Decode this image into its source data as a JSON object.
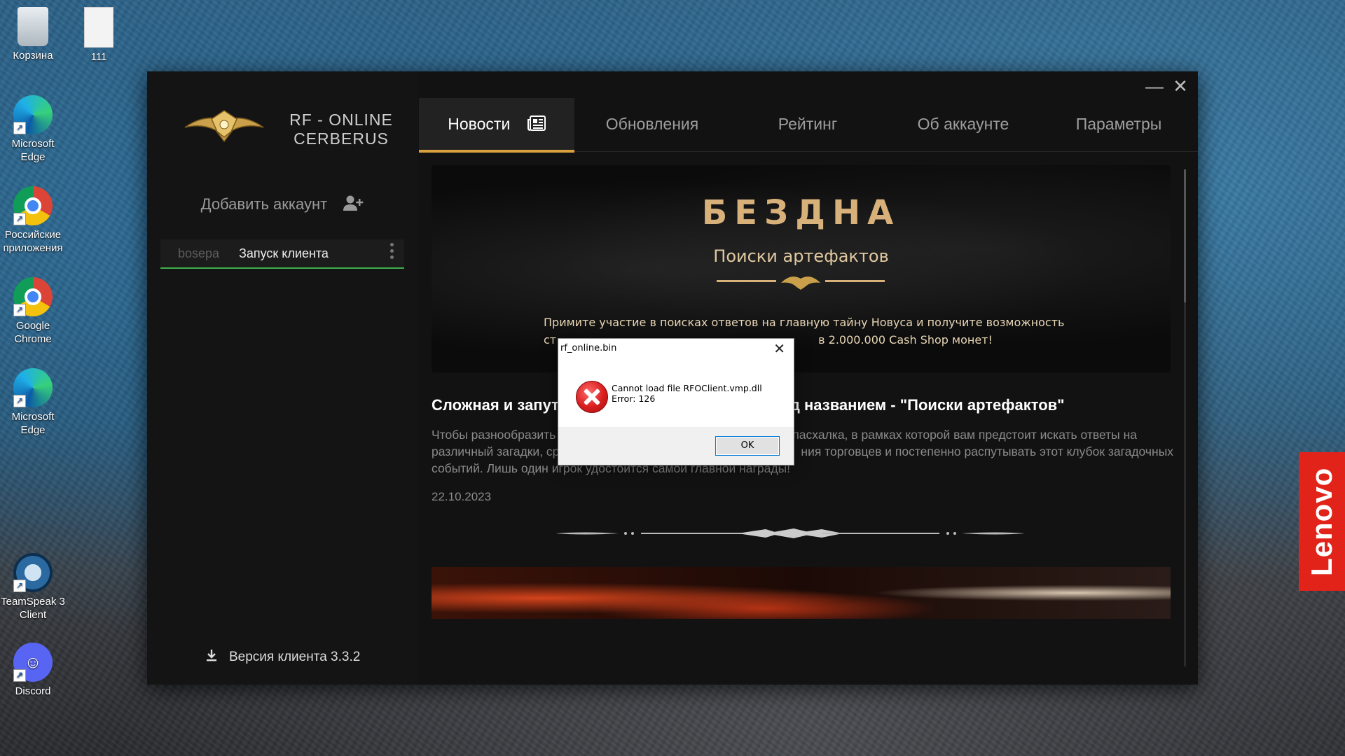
{
  "desktop": {
    "icons": [
      {
        "label": "Корзина",
        "icon": "recycle-bin-icon"
      },
      {
        "label": "111",
        "icon": "file-icon"
      },
      {
        "label": "Microsoft Edge",
        "icon": "edge-icon"
      },
      {
        "label": "Российские приложения",
        "icon": "chrome-icon"
      },
      {
        "label": "Google Chrome",
        "icon": "chrome-icon"
      },
      {
        "label": "Microsoft Edge",
        "icon": "edge-icon"
      },
      {
        "label": "TeamSpeak 3 Client",
        "icon": "teamspeak-icon"
      },
      {
        "label": "Discord",
        "icon": "discord-icon"
      }
    ],
    "brand_label": "Lenovo"
  },
  "launcher": {
    "logo_text_line1": "RF - ONLINE",
    "logo_text_line2": "CERBERUS",
    "add_account": "Добавить аккаунт",
    "account": {
      "name": "bosepa",
      "action": "Запуск клиента"
    },
    "version": "Версия клиента 3.3.2",
    "tabs": [
      "Новости",
      "Обновления",
      "Рейтинг",
      "Об аккаунте",
      "Параметры"
    ],
    "active_tab": "Новости",
    "accent_color": "#d9a23e",
    "banner": {
      "title": "БЕЗДНА",
      "subtitle": "Поиски артефактов",
      "text_line1": "Примите участие в поисках ответов на главную тайну Новуса и получите возможность",
      "text_line2": "ст",
      "text_line2b": "в 2.000.000 Cash Shop монет!"
    },
    "article": {
      "title_part1": "Сложная и запут",
      "title_part2": "д названием - \"Поиски артефактов\"",
      "text_line1a": "Чтобы разнообразить",
      "text_line1b": "пасхалка, в рамках которой вам предстоит искать ответы на",
      "text_line2a": "различный загадки, ср",
      "text_line2b": "ния торговцев и постепенно распутывать этот клубок загадочных",
      "text_line3": "событий. Лишь один игрок удостоится самой главной награды!",
      "date": "22.10.2023"
    }
  },
  "dialog": {
    "title": "rf_online.bin",
    "message_line1": "Cannot load file RFOClient.vmp.dll",
    "message_line2": "Error: 126",
    "ok_label": "OK"
  }
}
